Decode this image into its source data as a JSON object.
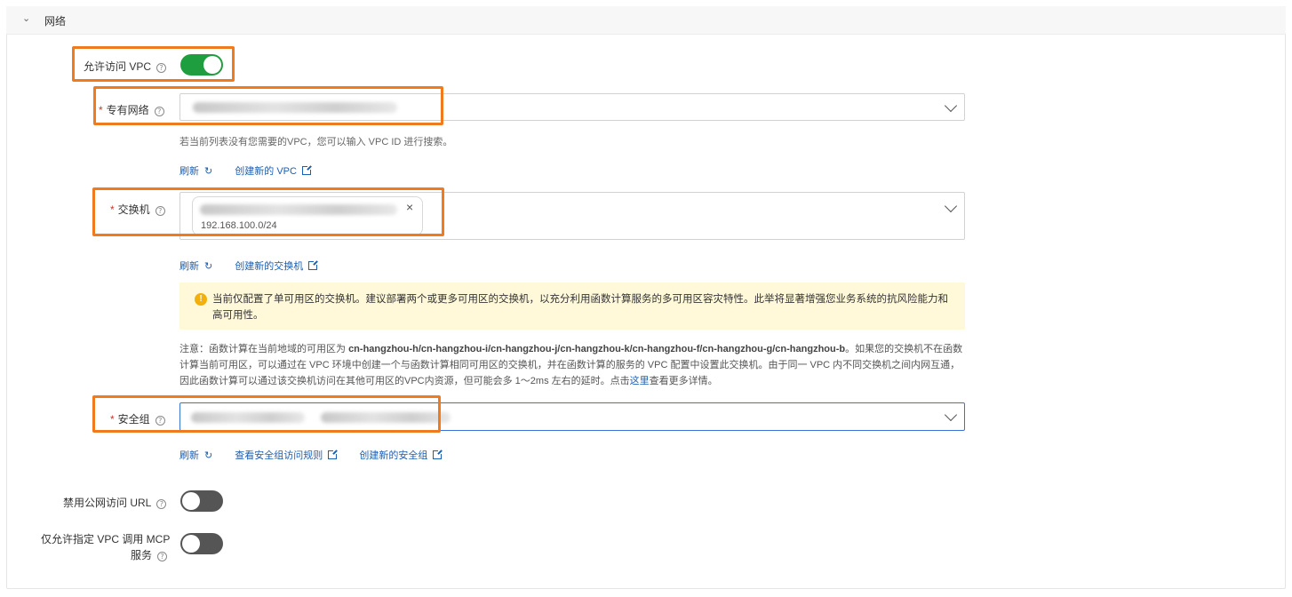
{
  "section": {
    "title": "网络"
  },
  "allow_vpc": {
    "label": "允许访问 VPC",
    "enabled": true
  },
  "vpc": {
    "label": "专有网络",
    "hint": "若当前列表没有您需要的VPC，您可以输入 VPC ID 进行搜索。",
    "refresh_label": "刷新",
    "create_label": "创建新的 VPC"
  },
  "vswitch": {
    "label": "交换机",
    "selected_cidr": "192.168.100.0/24",
    "refresh_label": "刷新",
    "create_label": "创建新的交换机",
    "warning": "当前仅配置了单可用区的交换机。建议部署两个或更多可用区的交换机，以充分利用函数计算服务的多可用区容灾特性。此举将显著增强您业务系统的抗风险能力和高可用性。",
    "note_prefix": "注意：函数计算在当前地域的可用区为 ",
    "note_zones": "cn-hangzhou-h/cn-hangzhou-i/cn-hangzhou-j/cn-hangzhou-k/cn-hangzhou-f/cn-hangzhou-g/cn-hangzhou-b",
    "note_body": "。如果您的交换机不在函数计算当前可用区，可以通过在 VPC 环境中创建一个与函数计算相同可用区的交换机，并在函数计算的服务的 VPC 配置中设置此交换机。由于同一 VPC 内不同交换机之间内网互通，因此函数计算可以通过该交换机访问在其他可用区的VPC内资源，但可能会多 1～2ms 左右的延时。点击",
    "note_link": "这里",
    "note_suffix": "查看更多详情。"
  },
  "security_group": {
    "label": "安全组",
    "refresh_label": "刷新",
    "view_rules_label": "查看安全组访问规则",
    "create_label": "创建新的安全组"
  },
  "disable_public_url": {
    "label": "禁用公网访问 URL",
    "enabled": false
  },
  "vpc_only_mcp": {
    "label_line1": "仅允许指定 VPC 调用 MCP",
    "label_line2": "服务",
    "enabled": false
  },
  "colors": {
    "toggle_on": "#1e9e3f",
    "toggle_off": "#555555",
    "link": "#1a5fb4",
    "highlight": "#f07a1e",
    "warning_bg": "#fff8d9"
  }
}
